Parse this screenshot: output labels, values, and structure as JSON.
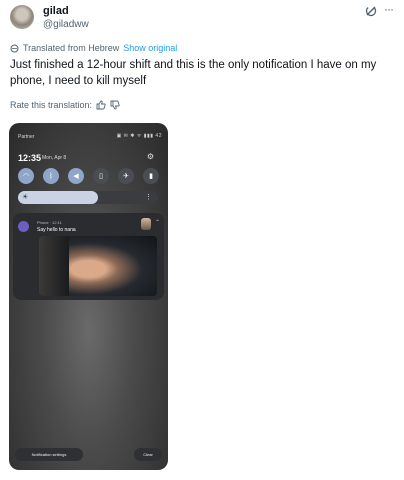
{
  "tweet": {
    "name": "gilad",
    "handle": "@giladww",
    "translated_prefix": "Translated from Hebrew",
    "show_original": "Show original",
    "text": "Just finished a 12-hour shift and this is the only notification I have on my phone, I need to kill myself",
    "rate_label": "Rate this translation:"
  },
  "phone": {
    "carrier": "Partner",
    "status_icons": "▣ ✉ ✱ ᯤ ▮▮▮ 42",
    "time": "12:35",
    "date": "Mon, Apr 8",
    "notification": {
      "app": "Phone · 12:11",
      "message": "Say hello to nana"
    },
    "buttons": {
      "settings": "Notification settings",
      "clear": "Clear"
    }
  }
}
